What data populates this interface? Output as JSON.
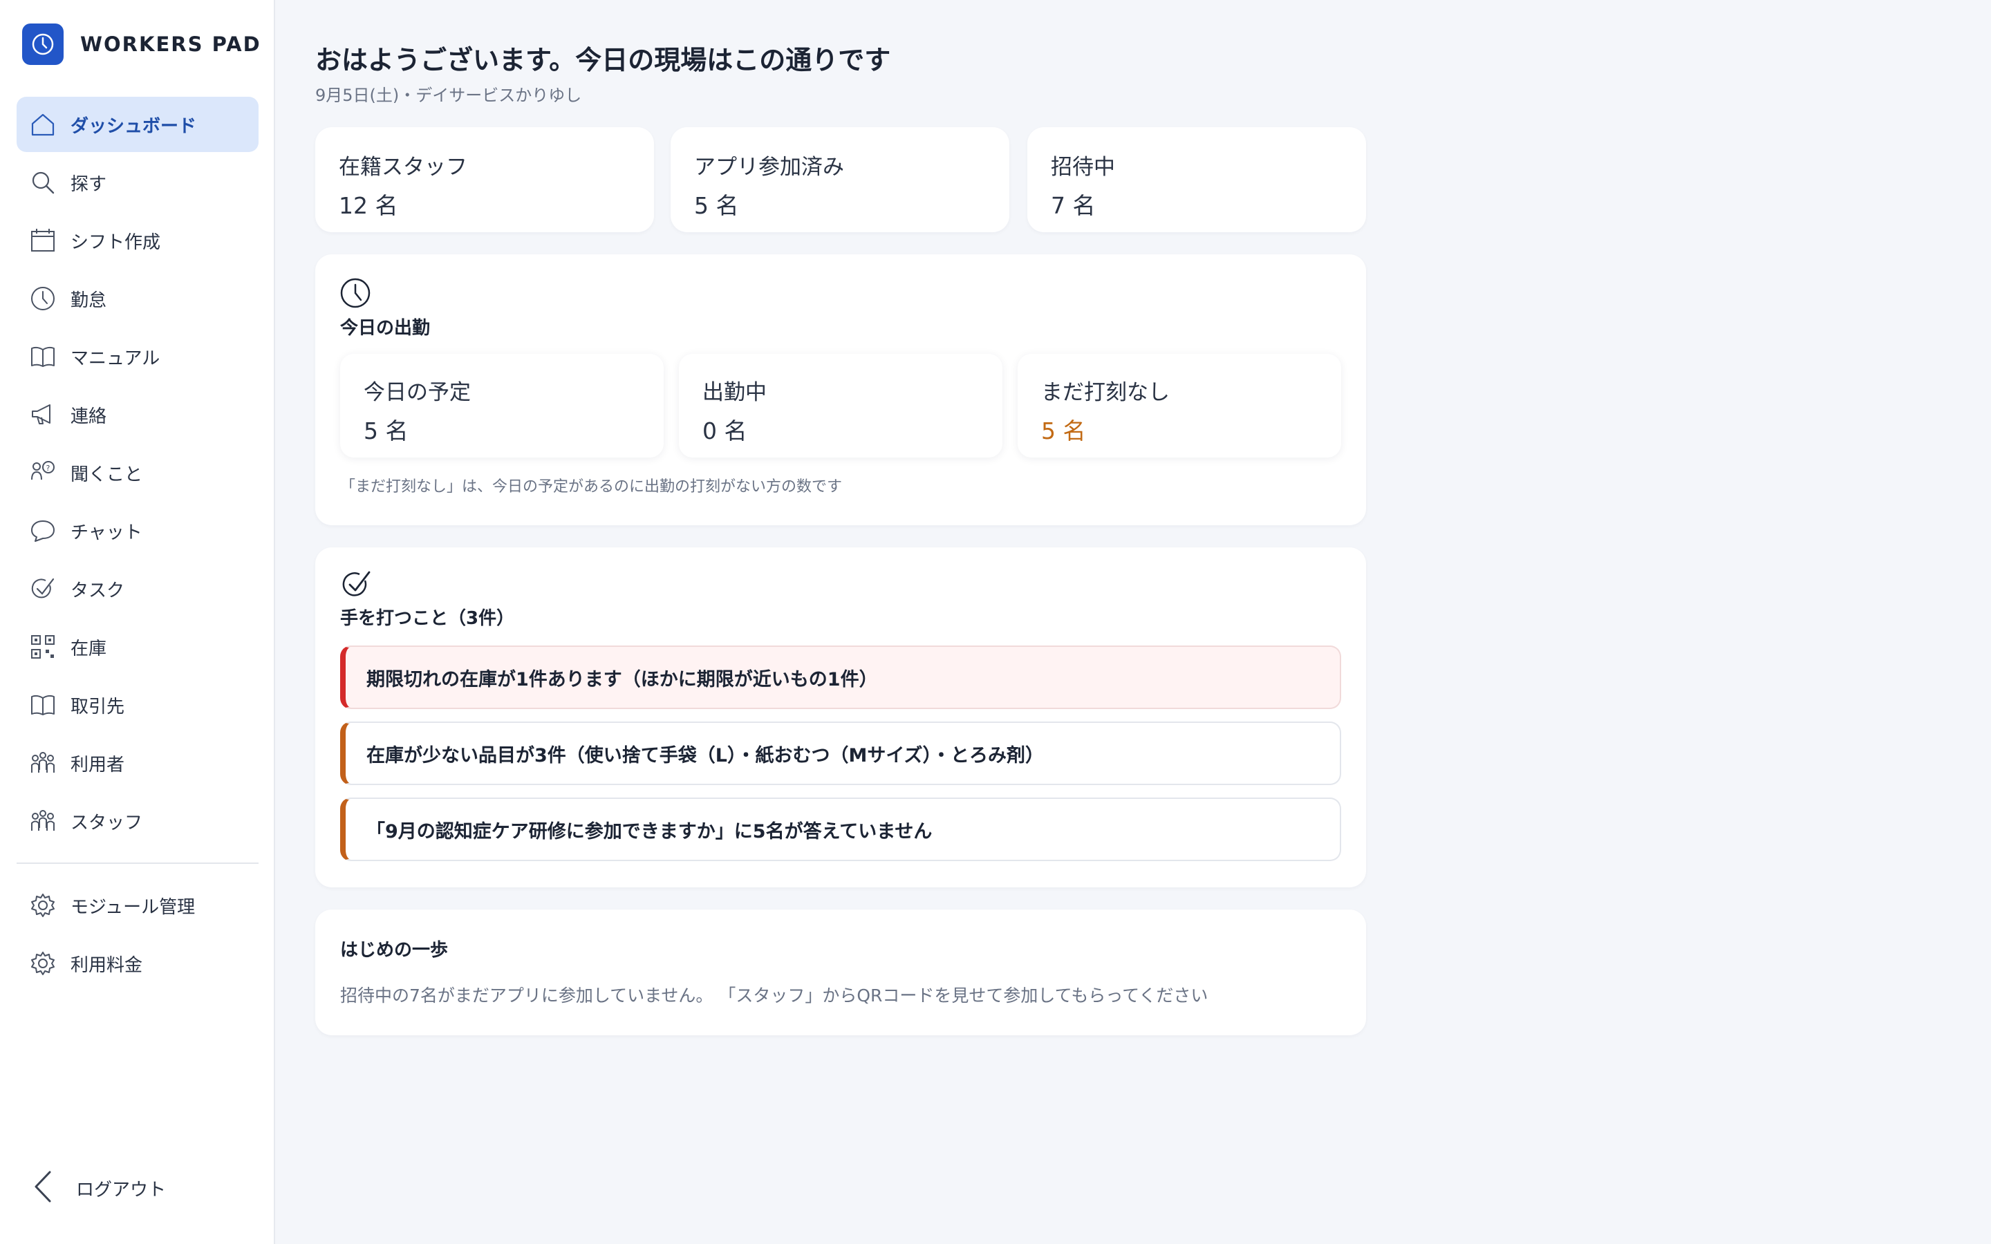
{
  "brand": {
    "name": "WORKERS PAD",
    "accent": "#2256c8"
  },
  "sidebar": {
    "items": [
      {
        "label": "ダッシュボード",
        "icon": "home-icon",
        "active": true
      },
      {
        "label": "探す",
        "icon": "search-icon"
      },
      {
        "label": "シフト作成",
        "icon": "calendar-icon"
      },
      {
        "label": "勤怠",
        "icon": "clock-icon"
      },
      {
        "label": "マニュアル",
        "icon": "book-icon"
      },
      {
        "label": "連絡",
        "icon": "megaphone-icon"
      },
      {
        "label": "聞くこと",
        "icon": "question-people-icon"
      },
      {
        "label": "チャット",
        "icon": "chat-bubble-icon"
      },
      {
        "label": "タスク",
        "icon": "check-icon"
      },
      {
        "label": "在庫",
        "icon": "qr-code-icon"
      },
      {
        "label": "取引先",
        "icon": "book-icon"
      },
      {
        "label": "利用者",
        "icon": "people-icon"
      },
      {
        "label": "スタッフ",
        "icon": "people-icon"
      }
    ],
    "admin_items": [
      {
        "label": "モジュール管理",
        "icon": "gear-icon"
      },
      {
        "label": "利用料金",
        "icon": "gear-icon"
      }
    ],
    "logout_label": "ログアウト"
  },
  "header": {
    "greeting": "おはようございます。今日の現場はこの通りです",
    "subtitle": "9月5日(土)・デイサービスかりゆし"
  },
  "stats": [
    {
      "label": "在籍スタッフ",
      "value": "12 名"
    },
    {
      "label": "アプリ参加済み",
      "value": "5 名"
    },
    {
      "label": "招待中",
      "value": "7 名"
    }
  ],
  "attendance": {
    "title": "今日の出勤",
    "cards": [
      {
        "label": "今日の予定",
        "value": "5 名"
      },
      {
        "label": "出勤中",
        "value": "0 名"
      },
      {
        "label": "まだ打刻なし",
        "value": "5 名",
        "warn_color": "#c26a14"
      }
    ],
    "note": "「まだ打刻なし」は、今日の予定があるのに出勤の打刻がない方の数です"
  },
  "actions": {
    "title": "手を打つこと（3件）",
    "items": [
      {
        "text": "期限切れの在庫が1件あります（ほかに期限が近いもの1件）",
        "level": "danger",
        "color": "#d42a2a"
      },
      {
        "text": "在庫が少ない品目が3件（使い捨て手袋（L）・紙おむつ（Mサイズ）・とろみ剤）",
        "level": "warning",
        "color": "#c2601a"
      },
      {
        "text": "「9月の認知症ケア研修に参加できますか」に5名が答えていません",
        "level": "warning",
        "color": "#c2601a"
      }
    ]
  },
  "first_step": {
    "title": "はじめの一歩",
    "text": "招待中の7名がまだアプリに参加していません。 「スタッフ」からQRコードを見せて参加してもらってください"
  }
}
